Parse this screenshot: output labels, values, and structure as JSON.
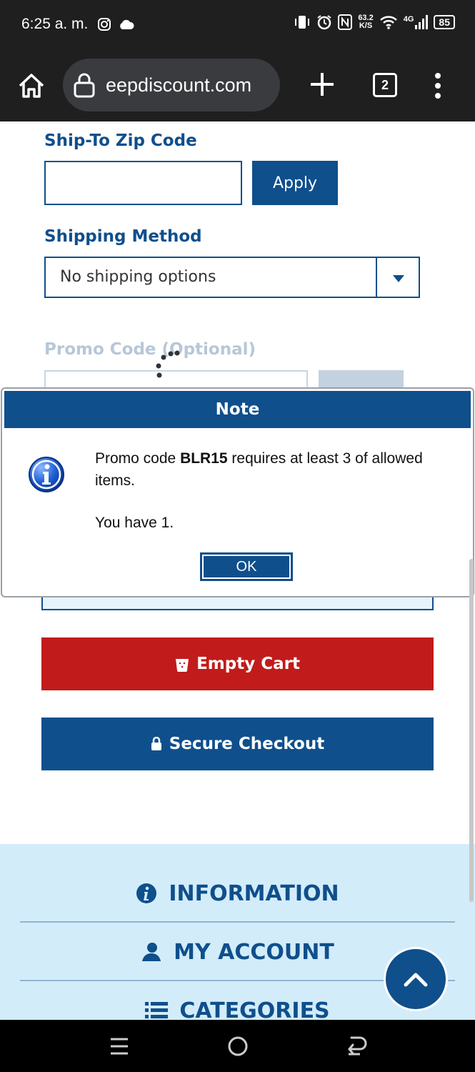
{
  "status_bar": {
    "time": "6:25 a. m.",
    "speed_value": "63.2",
    "speed_unit": "K/S",
    "network": "4G",
    "battery": "85"
  },
  "browser": {
    "url": "eepdiscount.com",
    "tab_count": "2"
  },
  "form": {
    "zip_label": "Ship-To Zip Code",
    "zip_value": "",
    "apply_label": "Apply",
    "shipping_label": "Shipping Method",
    "shipping_value": "No shipping options",
    "promo_label": "Promo Code (Optional)"
  },
  "modal": {
    "title": "Note",
    "message_prefix": "Promo code ",
    "code": "BLR15",
    "message_suffix": " requires at least 3 of allowed items.",
    "message_line2": "You have 1.",
    "ok_label": "OK"
  },
  "cart": {
    "empty_label": "Empty Cart",
    "checkout_label": "Secure Checkout"
  },
  "footer": {
    "items": [
      {
        "label": "INFORMATION",
        "icon": "info-circle-icon"
      },
      {
        "label": "MY ACCOUNT",
        "icon": "user-icon"
      },
      {
        "label": "CATEGORIES",
        "icon": "list-icon"
      }
    ]
  },
  "colors": {
    "brand_blue": "#0f4f8c",
    "danger_red": "#c21b1b",
    "footer_bg": "#d3ecfa"
  }
}
